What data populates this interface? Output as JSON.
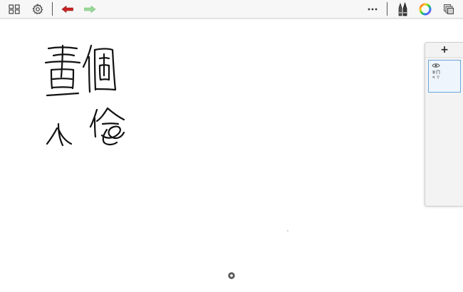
{
  "toolbar": {
    "left_icons": [
      "grid-icon",
      "gear-icon",
      "undo-arrow-icon",
      "redo-arrow-icon"
    ],
    "right_icons": [
      "more-icon",
      "brushes-icon",
      "color-wheel-icon",
      "layers-icon"
    ],
    "undo_color": "#cc2222",
    "redo_color": "#8fd48f"
  },
  "canvas": {
    "background": "#ffffff",
    "handwriting": "畫個小倫"
  },
  "layers_panel": {
    "add_label": "+",
    "layers": [
      {
        "visible": true
      }
    ],
    "accent": "#6aa6e0"
  }
}
